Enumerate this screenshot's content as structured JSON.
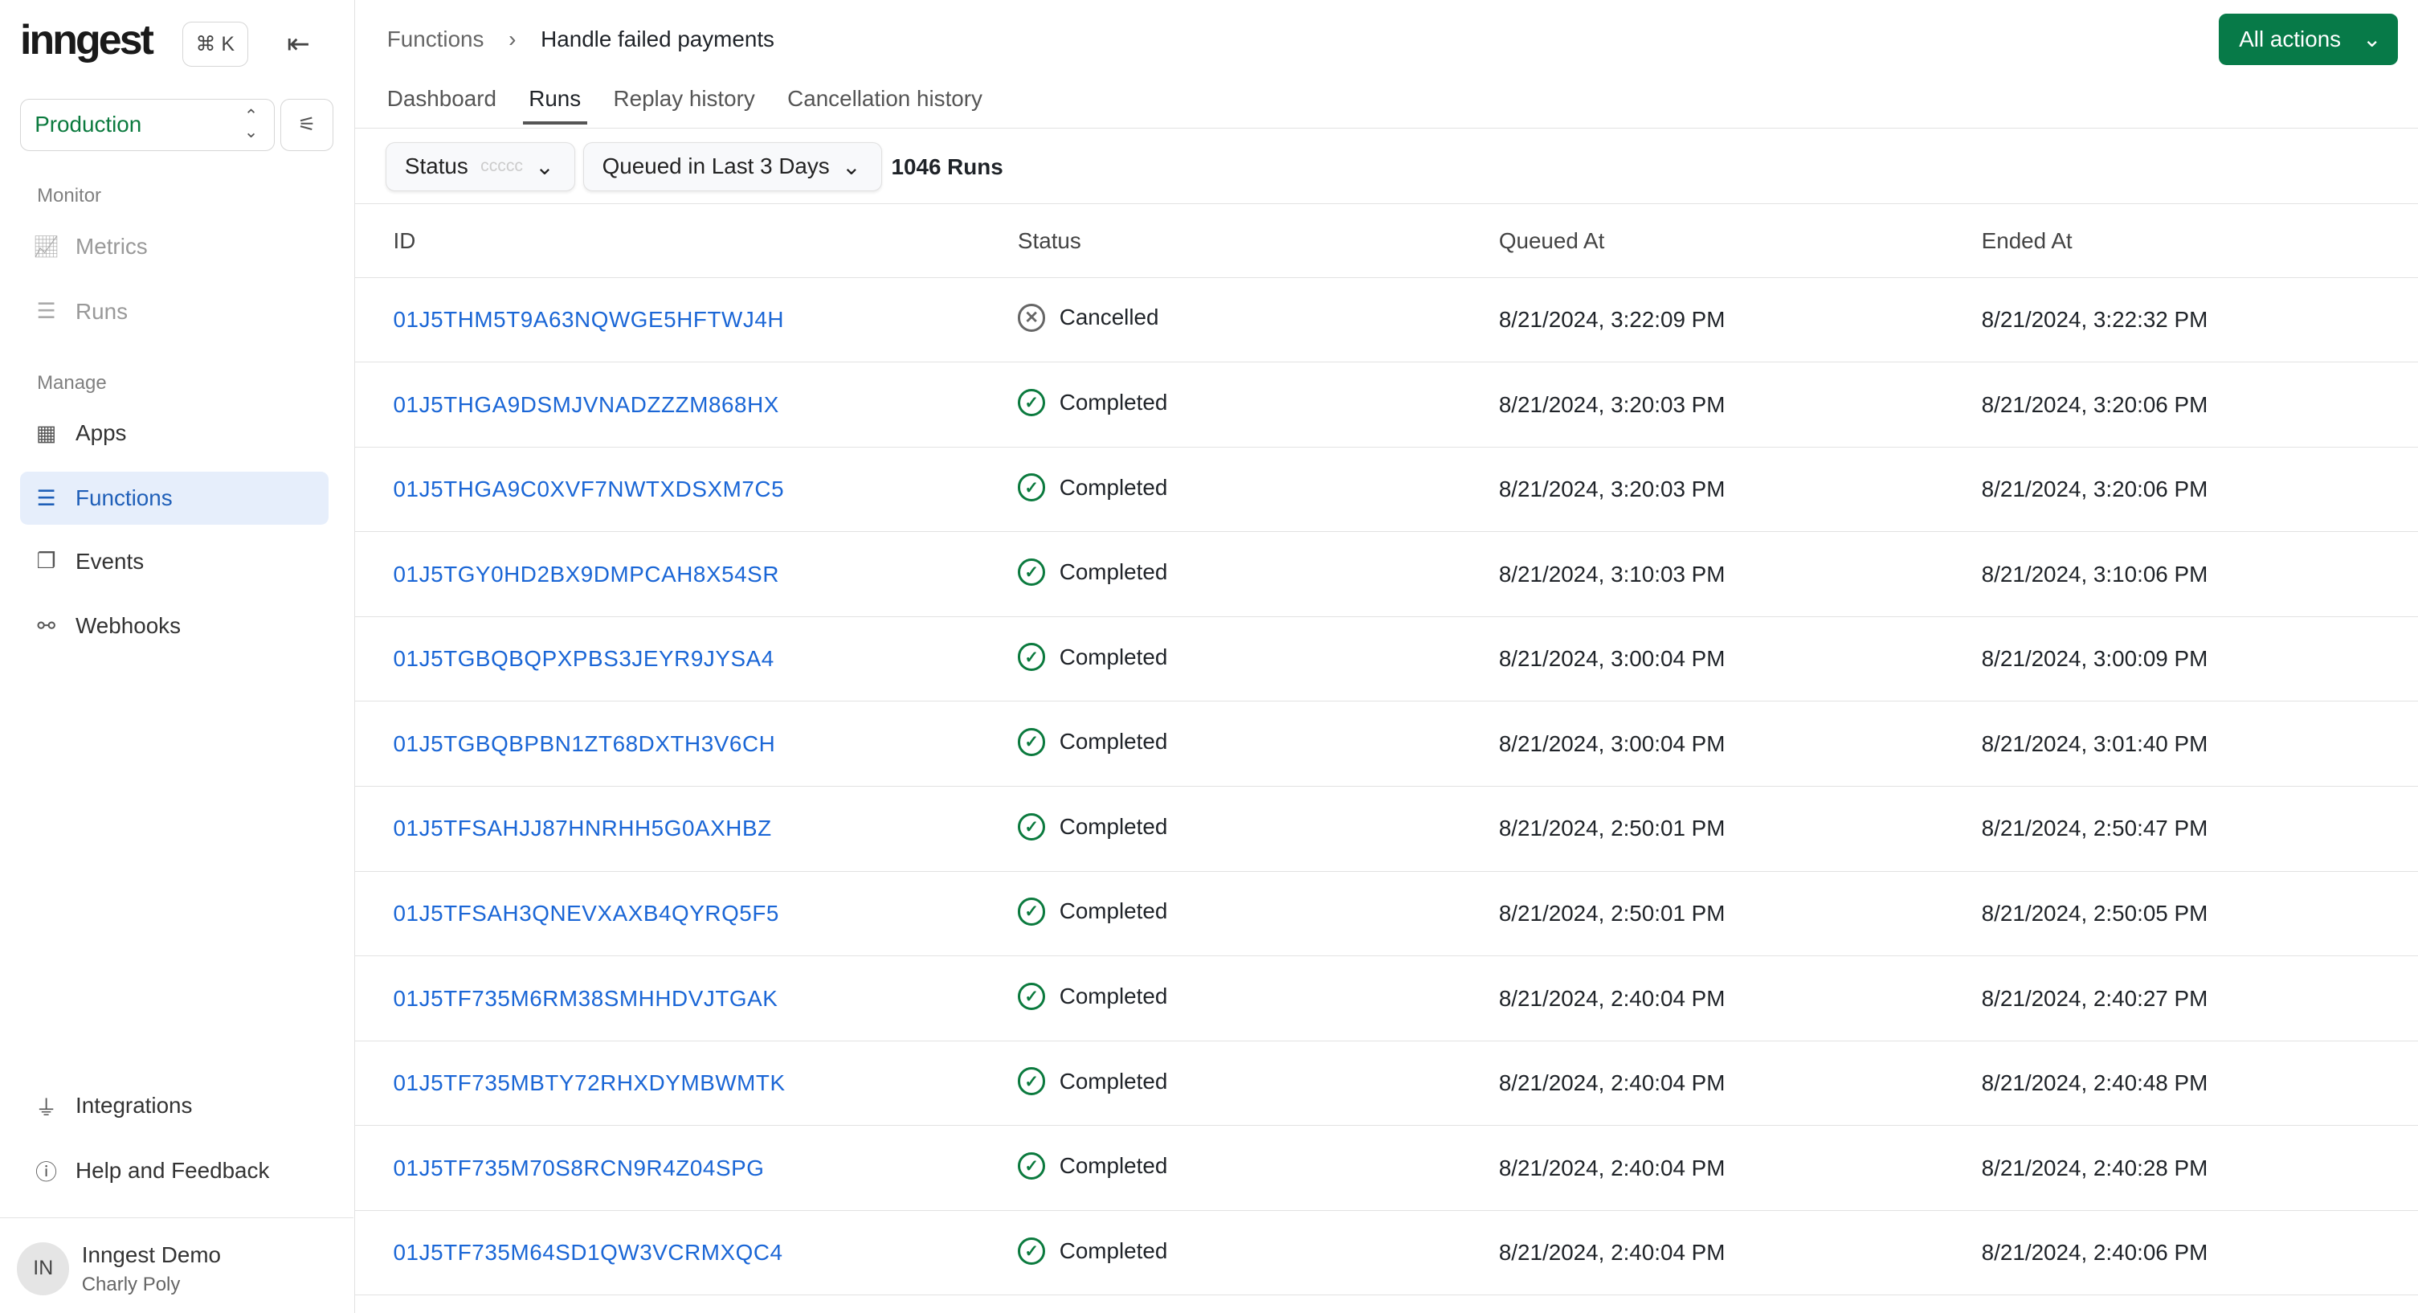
{
  "sidebar": {
    "logo": "inngest",
    "shortcut": "⌘ K",
    "environment": "Production",
    "sections": {
      "monitor": "Monitor",
      "manage": "Manage"
    },
    "items": [
      {
        "label": "Metrics"
      },
      {
        "label": "Runs"
      },
      {
        "label": "Apps"
      },
      {
        "label": "Functions"
      },
      {
        "label": "Events"
      },
      {
        "label": "Webhooks"
      },
      {
        "label": "Integrations"
      },
      {
        "label": "Help and Feedback"
      }
    ],
    "profile": {
      "initials": "IN",
      "org": "Inngest Demo",
      "user": "Charly Poly"
    }
  },
  "header": {
    "breadcrumb": [
      "Functions",
      "Handle failed payments"
    ],
    "all_actions": "All actions"
  },
  "tabs": [
    {
      "label": "Dashboard"
    },
    {
      "label": "Runs"
    },
    {
      "label": "Replay history"
    },
    {
      "label": "Cancellation history"
    }
  ],
  "filters": {
    "status_label": "Status",
    "status_placeholder": "ccccc",
    "time_range": "Queued in Last 3 Days",
    "count": "1046 Runs"
  },
  "table": {
    "columns": [
      "ID",
      "Status",
      "Queued At",
      "Ended At"
    ],
    "rows": [
      [
        "01J5THM5T9A63NQWGE5HFTWJ4H",
        "Cancelled",
        "8/21/2024, 3:22:09 PM",
        "8/21/2024, 3:22:32 PM"
      ],
      [
        "01J5THGA9DSMJVNADZZZM868HX",
        "Completed",
        "8/21/2024, 3:20:03 PM",
        "8/21/2024, 3:20:06 PM"
      ],
      [
        "01J5THGA9C0XVF7NWTXDSXM7C5",
        "Completed",
        "8/21/2024, 3:20:03 PM",
        "8/21/2024, 3:20:06 PM"
      ],
      [
        "01J5TGY0HD2BX9DMPCAH8X54SR",
        "Completed",
        "8/21/2024, 3:10:03 PM",
        "8/21/2024, 3:10:06 PM"
      ],
      [
        "01J5TGBQBQPXPBS3JEYR9JYSA4",
        "Completed",
        "8/21/2024, 3:00:04 PM",
        "8/21/2024, 3:00:09 PM"
      ],
      [
        "01J5TGBQBPBN1ZT68DXTH3V6CH",
        "Completed",
        "8/21/2024, 3:00:04 PM",
        "8/21/2024, 3:01:40 PM"
      ],
      [
        "01J5TFSAHJJ87HNRHH5G0AXHBZ",
        "Completed",
        "8/21/2024, 2:50:01 PM",
        "8/21/2024, 2:50:47 PM"
      ],
      [
        "01J5TFSAH3QNEVXAXB4QYRQ5F5",
        "Completed",
        "8/21/2024, 2:50:01 PM",
        "8/21/2024, 2:50:05 PM"
      ],
      [
        "01J5TF735M6RM38SMHHDVJTGAK",
        "Completed",
        "8/21/2024, 2:40:04 PM",
        "8/21/2024, 2:40:27 PM"
      ],
      [
        "01J5TF735MBTY72RHXDYMBWMTK",
        "Completed",
        "8/21/2024, 2:40:04 PM",
        "8/21/2024, 2:40:48 PM"
      ],
      [
        "01J5TF735M70S8RCN9R4Z04SPG",
        "Completed",
        "8/21/2024, 2:40:04 PM",
        "8/21/2024, 2:40:28 PM"
      ],
      [
        "01J5TF735M64SD1QW3VCRMXQC4",
        "Completed",
        "8/21/2024, 2:40:04 PM",
        "8/21/2024, 2:40:06 PM"
      ]
    ]
  },
  "colors": {
    "brand_green": "#077a48",
    "link_blue": "#1a66d6",
    "active_bg": "#e6eefb"
  }
}
